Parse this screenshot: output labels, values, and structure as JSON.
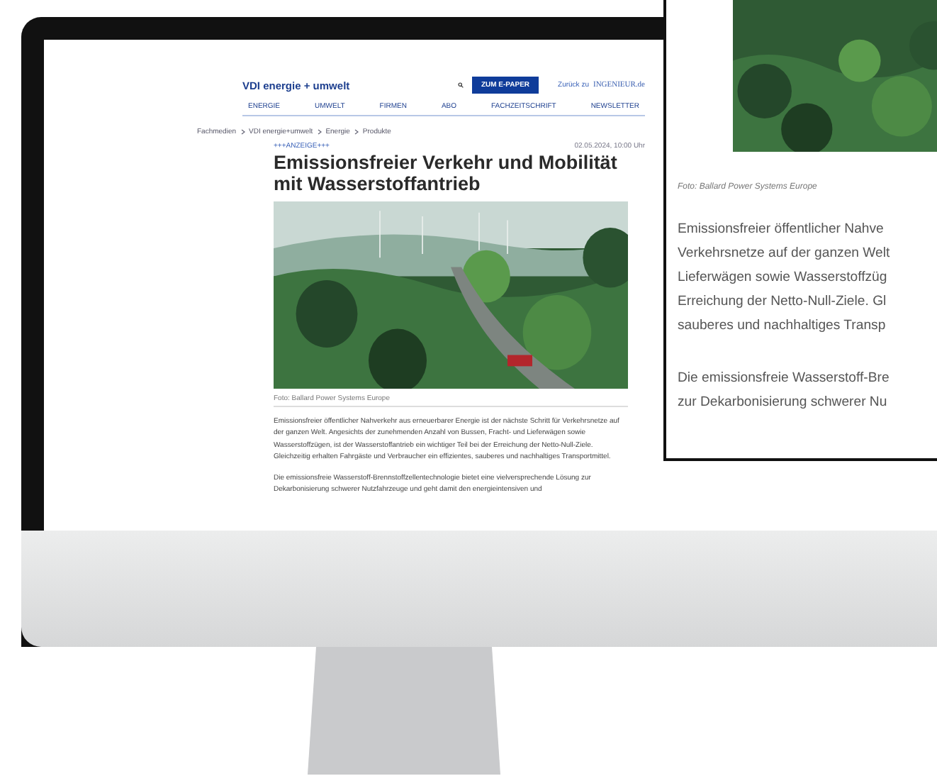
{
  "site": {
    "logo": "VDI energie + umwelt",
    "epaper_button": "ZUM E-PAPER",
    "back_label": "Zurück zu",
    "back_logo": "INGENIEUR.de"
  },
  "nav": [
    "ENERGIE",
    "UMWELT",
    "FIRMEN",
    "ABO",
    "FACHZEITSCHRIFT",
    "NEWSLETTER"
  ],
  "breadcrumb": [
    "Fachmedien",
    "VDI energie+umwelt",
    "Energie",
    "Produkte"
  ],
  "article": {
    "tag": "+++ANZEIGE+++",
    "date": "02.05.2024, 10:00 Uhr",
    "title": "Emissionsfreier Verkehr und Mobilität mit Wasserstoffantrieb",
    "caption": "Foto: Ballard Power Systems Europe",
    "paragraphs": [
      "Emissionsfreier öffentlicher Nahverkehr aus erneuerbarer Energie ist der nächste Schritt für Verkehrsnetze auf der ganzen Welt. Angesichts der zunehmenden Anzahl von Bussen, Fracht- und Lieferwägen sowie Wasserstoffzügen, ist der Wasserstoffantrieb ein wichtiger Teil bei der Erreichung der Netto-Null-Ziele. Gleichzeitig erhalten Fahrgäste und Verbraucher ein effizientes, sauberes und nachhaltiges Transportmittel.",
      "Die emissionsfreie Wasserstoff-Brennstoffzellentechnologie bietet eine vielversprechende Lösung zur Dekarbonisierung schwerer Nutzfahrzeuge und geht damit den energieintensiven und"
    ]
  },
  "zoom_inset": {
    "caption": "Foto: Ballard Power Systems Europe",
    "paragraphs": [
      [
        "Emissionsfreier öffentlicher Nahve",
        "Verkehrsnetze auf der ganzen Welt",
        "Lieferwägen sowie Wasserstoffzüg",
        "Erreichung der Netto-Null-Ziele. Gl",
        "sauberes und nachhaltiges Transp"
      ],
      [
        "Die emissionsfreie Wasserstoff-Bre",
        "zur Dekarbonisierung schwerer Nu"
      ]
    ]
  }
}
